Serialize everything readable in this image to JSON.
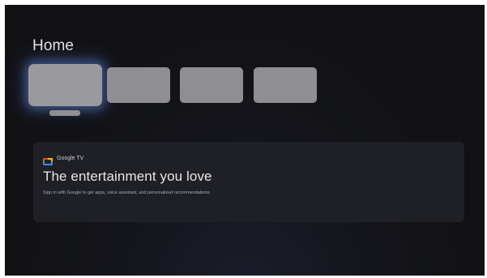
{
  "page": {
    "title": "Home"
  },
  "apps_row": {
    "tiles": [
      {
        "state": "focused"
      },
      {
        "state": "default"
      },
      {
        "state": "default"
      },
      {
        "state": "default"
      }
    ]
  },
  "promo_banner": {
    "brand_name": "Google TV",
    "brand_icon": "google-tv-icon",
    "heading": "The entertainment you love",
    "description": "Sign in with Google to get apps, voice assistant, and personalized recommendations."
  },
  "colors": {
    "background": "#121214",
    "tile": "#8f8f93",
    "focus_glow": "#5f7dc8",
    "banner": "#1f2026",
    "text_primary": "#e6e6e8",
    "text_secondary": "#a9aab0"
  }
}
